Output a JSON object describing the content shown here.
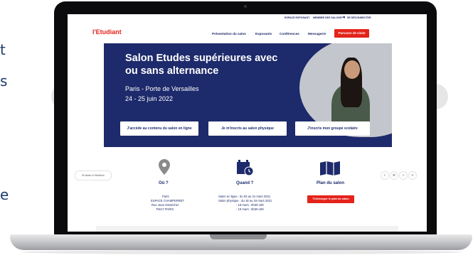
{
  "side_text": [
    "t",
    "s",
    "e"
  ],
  "topbar": {
    "items": [
      "ESPACE EXPOSANT",
      "MEMBRE DES SALONS",
      "SE DÉCONNECTER"
    ]
  },
  "nav": {
    "logo": "l'Etudiant",
    "links": [
      "Présentation du salon",
      "Exposants",
      "Conférences",
      "Messagerie"
    ],
    "cta": "Parcours de visite"
  },
  "hero": {
    "title_line1": "Salon Etudes supérieures avec",
    "title_line2": "ou sans alternance",
    "location": "Paris - Porte de Versailles",
    "dates": "24 - 25 juin 2022",
    "buttons": [
      "J'accède au contenu du salon en ligne",
      "Je m'inscris au salon physique",
      "J'inscris mon groupe scolaire"
    ]
  },
  "floating": {
    "chip_label": "Made in Webflow",
    "icons": [
      "search-icon",
      "zoom-icon",
      "code-icon",
      "menu-icon"
    ]
  },
  "info": {
    "where": {
      "title": "Où ?",
      "lines": [
        "Paris",
        "ESPACE CHAMPERRET",
        "Rue Jean Ostreicher",
        "75017 PARIS"
      ]
    },
    "when": {
      "title": "Quand ?",
      "lines": [
        "Salon en ligne : du 03 au 31 mars 2021",
        "Salon physique : du 18 au 19 mars 2021",
        "- 18 mars : 8h30-18h",
        "- 19 mars : 8h30-18h"
      ]
    },
    "plan": {
      "title": "Plan du salon",
      "button": "Télécharger le plan du salon"
    }
  },
  "colors": {
    "navy": "#1d2a6b",
    "red": "#e4231b",
    "grey": "#c3c6cc"
  }
}
